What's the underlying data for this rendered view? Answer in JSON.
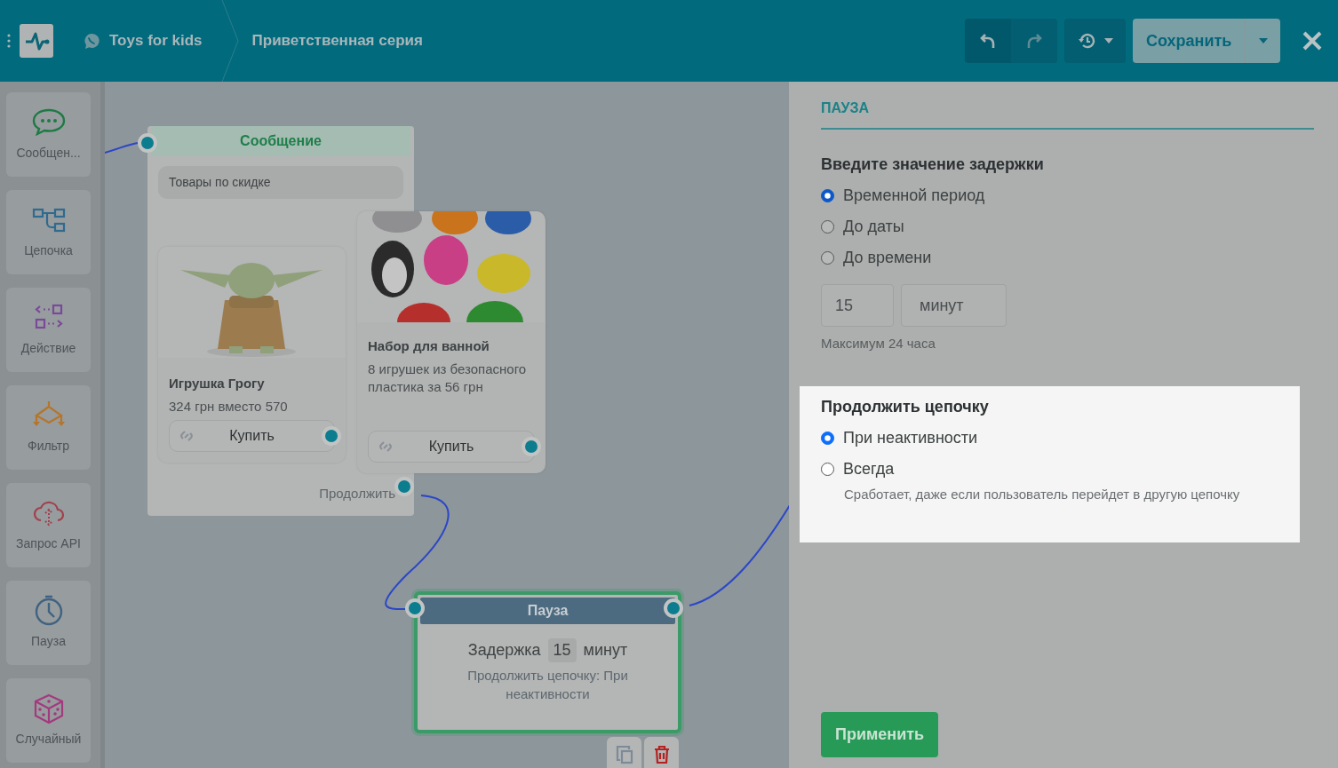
{
  "header": {
    "project": "Toys for kids",
    "flow": "Приветственная серия",
    "save_label": "Сохранить"
  },
  "sidebar": {
    "items": [
      {
        "label": "Сообщен...",
        "kind": "message"
      },
      {
        "label": "Цепочка",
        "kind": "chain"
      },
      {
        "label": "Действие",
        "kind": "action"
      },
      {
        "label": "Фильтр",
        "kind": "filter"
      },
      {
        "label": "Запрос API",
        "kind": "api"
      },
      {
        "label": "Пауза",
        "kind": "pause"
      },
      {
        "label": "Случайный",
        "kind": "random"
      }
    ]
  },
  "canvas": {
    "message_node": {
      "title": "Сообщение",
      "text": "Товары по скидке",
      "continue_label": "Продолжить",
      "cards": [
        {
          "title": "Игрушка Грогу",
          "description": "324 грн вместо 570",
          "button": "Купить",
          "kind": "picture"
        },
        {
          "title": "Набор для ванной",
          "description": "8 игрушек из безопасного пластика за 56 грн",
          "button": "Купить",
          "kind": "picture"
        }
      ]
    },
    "pause_node": {
      "title": "Пауза",
      "delay_label": "Задержка",
      "delay_value": "15",
      "delay_unit": "минут",
      "note": "Продолжить цепочку: При неактивности",
      "selected": true
    }
  },
  "panel": {
    "title": "ПАУЗА",
    "delay_heading": "Введите значение задержки",
    "delay_options": [
      {
        "label": "Временной период",
        "selected": true
      },
      {
        "label": "До даты",
        "selected": false
      },
      {
        "label": "До времени",
        "selected": false
      }
    ],
    "value": "15",
    "unit": "минут",
    "hint": "Максимум 24 часа",
    "continue_section": {
      "heading": "Продолжить цепочку",
      "highlighted": true,
      "options": [
        {
          "label": "При неактивности",
          "selected": true
        },
        {
          "label": "Всегда",
          "selected": false,
          "hint": "Сработает, даже если пользователь перейдет в другую цепочку"
        }
      ]
    },
    "apply_label": "Применить"
  }
}
